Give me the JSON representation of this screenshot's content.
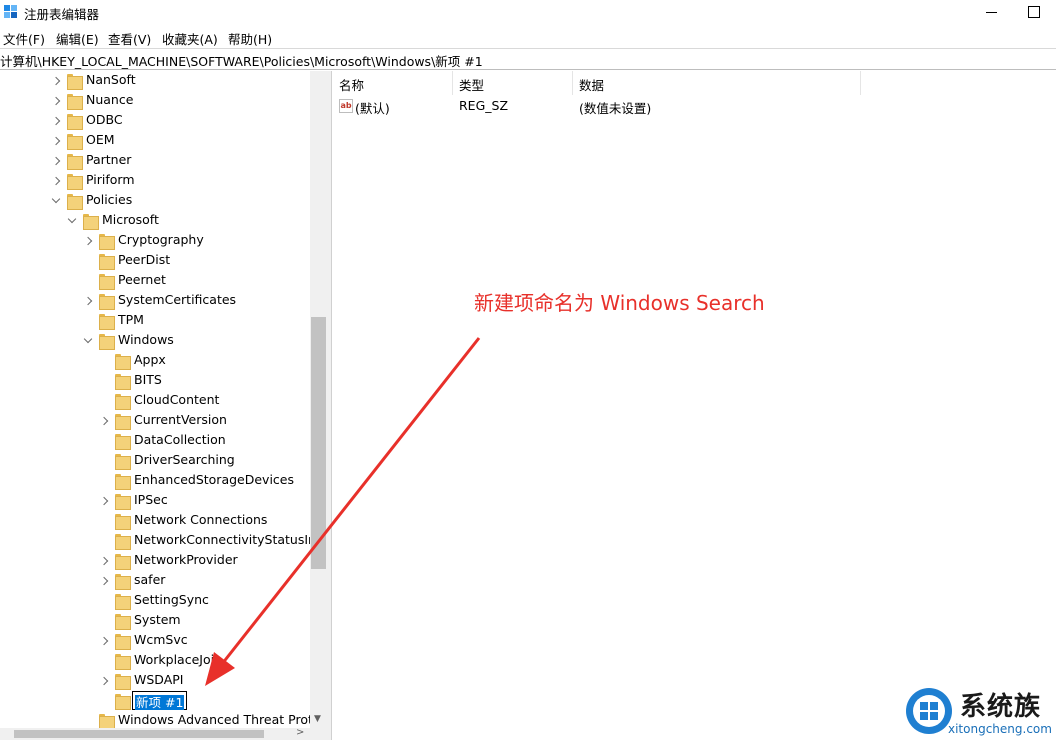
{
  "window": {
    "title": "注册表编辑器",
    "accent": "#0078d7"
  },
  "menu": {
    "items": [
      "文件(F)",
      "编辑(E)",
      "查看(V)",
      "收藏夹(A)",
      "帮助(H)"
    ]
  },
  "address": {
    "path": "计算机\\HKEY_LOCAL_MACHINE\\SOFTWARE\\Policies\\Microsoft\\Windows\\新项 #1"
  },
  "tree": {
    "items": [
      {
        "label": "NanSoft",
        "expander": "collapsed"
      },
      {
        "label": "Nuance",
        "expander": "collapsed"
      },
      {
        "label": "ODBC",
        "expander": "collapsed"
      },
      {
        "label": "OEM",
        "expander": "collapsed"
      },
      {
        "label": "Partner",
        "expander": "collapsed"
      },
      {
        "label": "Piriform",
        "expander": "collapsed"
      },
      {
        "label": "Policies",
        "expander": "expanded"
      },
      {
        "label": "Microsoft",
        "expander": "expanded"
      },
      {
        "label": "Cryptography",
        "expander": "collapsed"
      },
      {
        "label": "PeerDist",
        "expander": "none"
      },
      {
        "label": "Peernet",
        "expander": "none"
      },
      {
        "label": "SystemCertificates",
        "expander": "collapsed"
      },
      {
        "label": "TPM",
        "expander": "none"
      },
      {
        "label": "Windows",
        "expander": "expanded"
      },
      {
        "label": "Appx",
        "expander": "none"
      },
      {
        "label": "BITS",
        "expander": "none"
      },
      {
        "label": "CloudContent",
        "expander": "none"
      },
      {
        "label": "CurrentVersion",
        "expander": "collapsed"
      },
      {
        "label": "DataCollection",
        "expander": "none"
      },
      {
        "label": "DriverSearching",
        "expander": "none"
      },
      {
        "label": "EnhancedStorageDevices",
        "expander": "none"
      },
      {
        "label": "IPSec",
        "expander": "collapsed"
      },
      {
        "label": "Network Connections",
        "expander": "none"
      },
      {
        "label": "NetworkConnectivityStatusIndi",
        "expander": "none"
      },
      {
        "label": "NetworkProvider",
        "expander": "collapsed"
      },
      {
        "label": "safer",
        "expander": "collapsed"
      },
      {
        "label": "SettingSync",
        "expander": "none"
      },
      {
        "label": "System",
        "expander": "none"
      },
      {
        "label": "WcmSvc",
        "expander": "collapsed"
      },
      {
        "label": "WorkplaceJoin",
        "expander": "none"
      },
      {
        "label": "WSDAPI",
        "expander": "collapsed"
      },
      {
        "label": "新项 #1",
        "expander": "none",
        "editing": true
      },
      {
        "label": "Windows Advanced Threat Prote",
        "expander": "none"
      }
    ]
  },
  "list": {
    "columns": [
      "名称",
      "类型",
      "数据"
    ],
    "rows": [
      {
        "icon": "ab",
        "name": "(默认)",
        "type": "REG_SZ",
        "data": "(数值未设置)"
      }
    ]
  },
  "annotation": {
    "text": "新建项命名为 Windows Search",
    "color": "#e8302a"
  },
  "watermark": {
    "brand": "系统族",
    "url": "xitongcheng.com"
  }
}
